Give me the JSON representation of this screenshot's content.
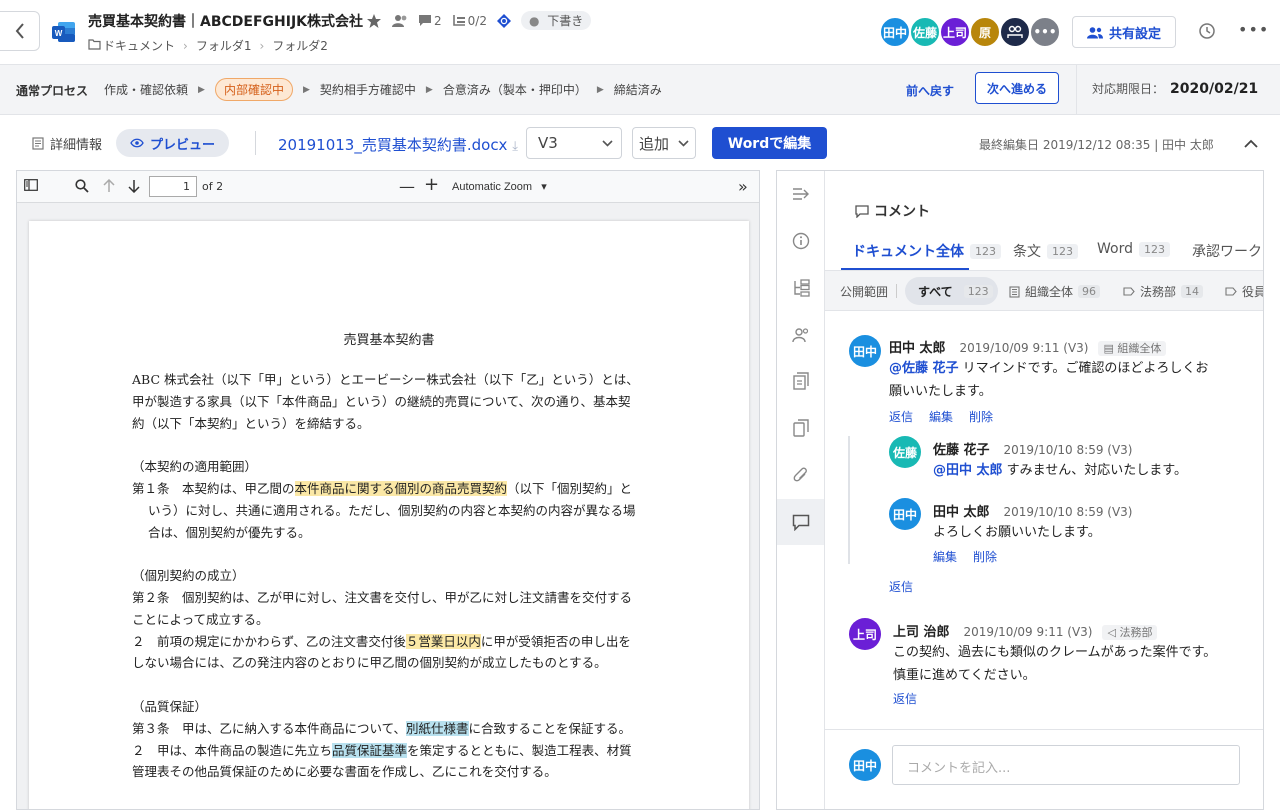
{
  "header": {
    "title": "売買基本契約書｜ABCDEFGHIJK株式会社",
    "comment_count": "2",
    "task_count": "0/2",
    "status": "下書き",
    "breadcrumbs": [
      "ドキュメント",
      "フォルダ1",
      "フォルダ2"
    ],
    "avatars": [
      {
        "label": "田中",
        "color": "#1a8fe0"
      },
      {
        "label": "佐藤",
        "color": "#18b9b4"
      },
      {
        "label": "上司",
        "color": "#6b1fd6"
      },
      {
        "label": "原",
        "color": "#b8860b"
      },
      {
        "label": "",
        "color": "#1e2a4a"
      },
      {
        "label": "•••",
        "color": "#7c8089"
      }
    ],
    "share_label": "共有設定"
  },
  "process": {
    "label": "通常プロセス",
    "steps": [
      "作成・確認依頼",
      "内部確認中",
      "契約相手方確認中",
      "合意済み（製本・押印中）",
      "締結済み"
    ],
    "active_step": "内部確認中",
    "prev_label": "前へ戻す",
    "next_label": "次へ進める",
    "deadline_label": "対応期限日：",
    "deadline_value": "2020/02/21"
  },
  "toolbar": {
    "details_label": "詳細情報",
    "preview_label": "プレビュー",
    "filename": "20191013_売買基本契約書.docx",
    "version": "V3",
    "add_label": "追加",
    "edit_word_label": "Wordで編集",
    "last_edit": "最終編集日 2019/12/12 08:35 | 田中 太郎"
  },
  "pdf": {
    "page_number": "1",
    "page_total": "of 2",
    "zoom": "Automatic Zoom",
    "title": "売買基本契約書",
    "para1_l1": "ABC 株式会社（以下「甲」という）とエービーシー株式会社（以下「乙」という）とは、",
    "para1_l2": "甲が製造する家具（以下「本件商品」という）の継続的売買について、次の通り、基本契",
    "para1_l3": "約（以下「本契約」という）を締結する。",
    "s1_head": "（本契約の適用範囲）",
    "s1_pre": "第１条　本契約は、甲乙間の",
    "s1_hl": "本件商品に関する個別の商品売買契約",
    "s1_post": "（以下「個別契約」と",
    "s1_l2": "いう）に対し、共通に適用される。ただし、個別契約の内容と本契約の内容が異なる場",
    "s1_l3": "合は、個別契約が優先する。",
    "s2_head": "（個別契約の成立）",
    "s2_l1": "第２条　個別契約は、乙が甲に対し、注文書を交付し、甲が乙に対し注文請書を交付する",
    "s2_l2": "ことによって成立する。",
    "s2_l3_pre": "２　前項の規定にかかわらず、乙の注文書交付後",
    "s2_l3_hl": "５営業日以内",
    "s2_l3_post": "に甲が受領拒否の申し出を",
    "s2_l4": "しない場合には、乙の発注内容のとおりに甲乙間の個別契約が成立したものとする。",
    "s3_head": "（品質保証）",
    "s3_l1_pre": "第３条　甲は、乙に納入する本件商品について、",
    "s3_l1_hl": "別紙仕様書",
    "s3_l1_post": "に合致することを保証する。",
    "s3_l2_pre": "２　甲は、本件商品の製造に先立ち",
    "s3_l2_hl": "品質保証基準",
    "s3_l2_post": "を策定するとともに、製造工程表、材質",
    "s3_l3": "管理表その他品質保証のために必要な書面を作成し、乙にこれを交付する。"
  },
  "comments_panel": {
    "header": "コメント",
    "tabs": [
      {
        "label": "ドキュメント全体",
        "count": "123"
      },
      {
        "label": "条文",
        "count": "123"
      },
      {
        "label": "Word",
        "count": "123"
      },
      {
        "label": "承認ワークフ",
        "count": ""
      }
    ],
    "filter_label": "公開範囲",
    "filters": [
      {
        "label": "すべて",
        "count": "123"
      },
      {
        "label": "組織全体",
        "count": "96"
      },
      {
        "label": "法務部",
        "count": "14"
      },
      {
        "label": "役員",
        "count": ""
      }
    ],
    "comments": [
      {
        "avatar": "田中",
        "color": "#1a8fe0",
        "name": "田中 太郎",
        "date": "2019/10/09 9:11 (V3)",
        "scope": "組織全体",
        "mention": "@佐藤 花子",
        "text_l1": " リマインドです。ご確認のほどよろしくお",
        "text_l2": "願いいたします。",
        "actions": [
          "返信",
          "編集",
          "削除"
        ]
      },
      {
        "avatar": "佐藤",
        "color": "#18b9b4",
        "name": "佐藤 花子",
        "date": "2019/10/10 8:59 (V3)",
        "mention": "@田中 太郎",
        "text_l1": " すみません、対応いたします。"
      },
      {
        "avatar": "田中",
        "color": "#1a8fe0",
        "name": "田中 太郎",
        "date": "2019/10/10 8:59 (V3)",
        "text_l1": "よろしくお願いいたします。",
        "actions": [
          "編集",
          "削除"
        ]
      },
      {
        "avatar": "上司",
        "color": "#6b1fd6",
        "name": "上司 治郎",
        "date": "2019/10/09 9:11 (V3)",
        "scope": "法務部",
        "text_l1": "この契約、過去にも類似のクレームがあった案件です。",
        "text_l2": "慎重に進めてください。",
        "actions": [
          "返信"
        ]
      }
    ],
    "thread_reply": "返信",
    "input_avatar": "田中",
    "input_placeholder": "コメントを記入..."
  },
  "icons": {
    "back": "chevron-left-icon",
    "word": "word-file-icon",
    "star": "star-icon",
    "people": "people-icon",
    "comment": "comment-icon",
    "task": "task-icon",
    "history": "history-icon",
    "more": "more-icon"
  }
}
